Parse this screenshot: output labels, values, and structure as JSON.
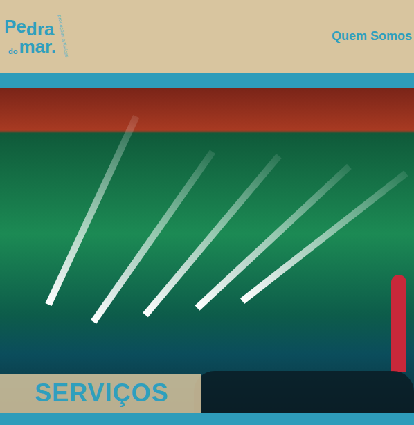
{
  "logo": {
    "lines": [
      "Pe",
      "dra",
      "do",
      "mar."
    ],
    "tagline": "produções artísticas"
  },
  "nav": [
    {
      "label": "Quem Somos"
    }
  ],
  "hero": {
    "title": "SERVIÇOS"
  }
}
